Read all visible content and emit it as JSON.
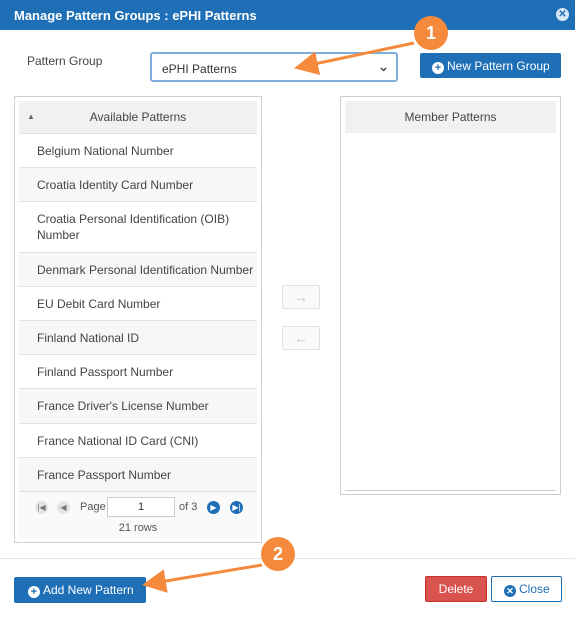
{
  "dialog": {
    "title": "Manage Pattern Groups : ePHI Patterns"
  },
  "pattern_group": {
    "label": "Pattern Group",
    "selected": "ePHI Patterns"
  },
  "buttons": {
    "new_pattern_group": "New Pattern Group",
    "add_new_pattern": "Add New Pattern",
    "delete": "Delete",
    "close": "Close",
    "move_right": "→",
    "move_left": "←"
  },
  "available": {
    "header": "Available Patterns",
    "items": [
      "Belgium National Number",
      "Croatia Identity Card Number",
      "Croatia Personal Identification (OIB) Number",
      "Denmark Personal Identification Number",
      "EU Debit Card Number",
      "Finland National ID",
      "Finland Passport Number",
      "France Driver's License Number",
      "France National ID Card (CNI)",
      "France Passport Number"
    ]
  },
  "member": {
    "header": "Member Patterns",
    "items": []
  },
  "pager": {
    "page_label": "Page",
    "page_value": "1",
    "of_label": "of 3",
    "row_count": "21 rows"
  },
  "callouts": [
    "1",
    "2"
  ],
  "colors": {
    "brand": "#1e6fb6",
    "danger": "#d9534f",
    "callout": "#f58a3c"
  },
  "icons": {
    "close": "close-circle-icon",
    "plus": "plus-circle-icon",
    "chevron": "chevron-down-icon",
    "sort": "sort-ascending-icon"
  }
}
